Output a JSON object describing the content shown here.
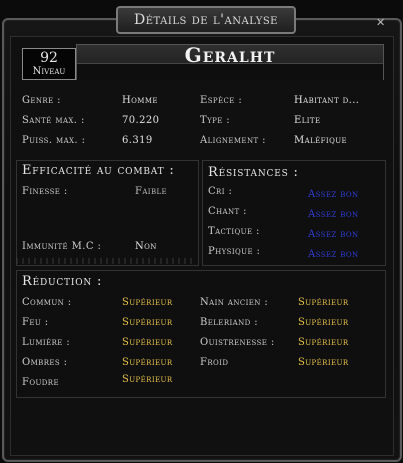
{
  "window": {
    "title": "Détails de l'analyse"
  },
  "header": {
    "level_value": "92",
    "level_label": "Niveau",
    "name": "Geralht"
  },
  "stats": [
    {
      "label": "Genre :",
      "value": "Homme"
    },
    {
      "label": "Santé max. :",
      "value": "70.220"
    },
    {
      "label": "Puiss. max. :",
      "value": "6.319"
    },
    {
      "label": "Espèce :",
      "value": "Habitant d..."
    },
    {
      "label": "Type :",
      "value": "Elite"
    },
    {
      "label": "Alignement :",
      "value": "Maléfique"
    }
  ],
  "efficacite": {
    "title": "Efficacité au combat :",
    "rows": [
      {
        "label": "Finesse :",
        "value": "Faible"
      },
      {
        "label": "Immunité M.C :",
        "value": "Non"
      }
    ]
  },
  "resistances": {
    "title": "Résistances :",
    "rows": [
      {
        "label": "Cri :",
        "value": "Assez bon"
      },
      {
        "label": "Chant :",
        "value": "Assez bon"
      },
      {
        "label": "Tactique :",
        "value": "Assez bon"
      },
      {
        "label": "Physique :",
        "value": "Assez bon"
      }
    ]
  },
  "reduction": {
    "title": "Réduction :",
    "rows": [
      {
        "label": "Commun :",
        "value": "Supérieur"
      },
      {
        "label": "Feu :",
        "value": "Supérieur"
      },
      {
        "label": "Lumière :",
        "value": "Supérieur"
      },
      {
        "label": "Ombres :",
        "value": "Supérieur"
      },
      {
        "label": "Foudre",
        "value": "Supérieur"
      },
      {
        "label": "Nain ancien :",
        "value": "Supérieur"
      },
      {
        "label": "Beleriand :",
        "value": "Supérieur"
      },
      {
        "label": "Ouistrenesse :",
        "value": "Supérieur"
      },
      {
        "label": "Froid",
        "value": "Supérieur"
      }
    ]
  },
  "colors": {
    "assez_bon": "#2f3fd8",
    "superieur": "#e8c34a"
  }
}
